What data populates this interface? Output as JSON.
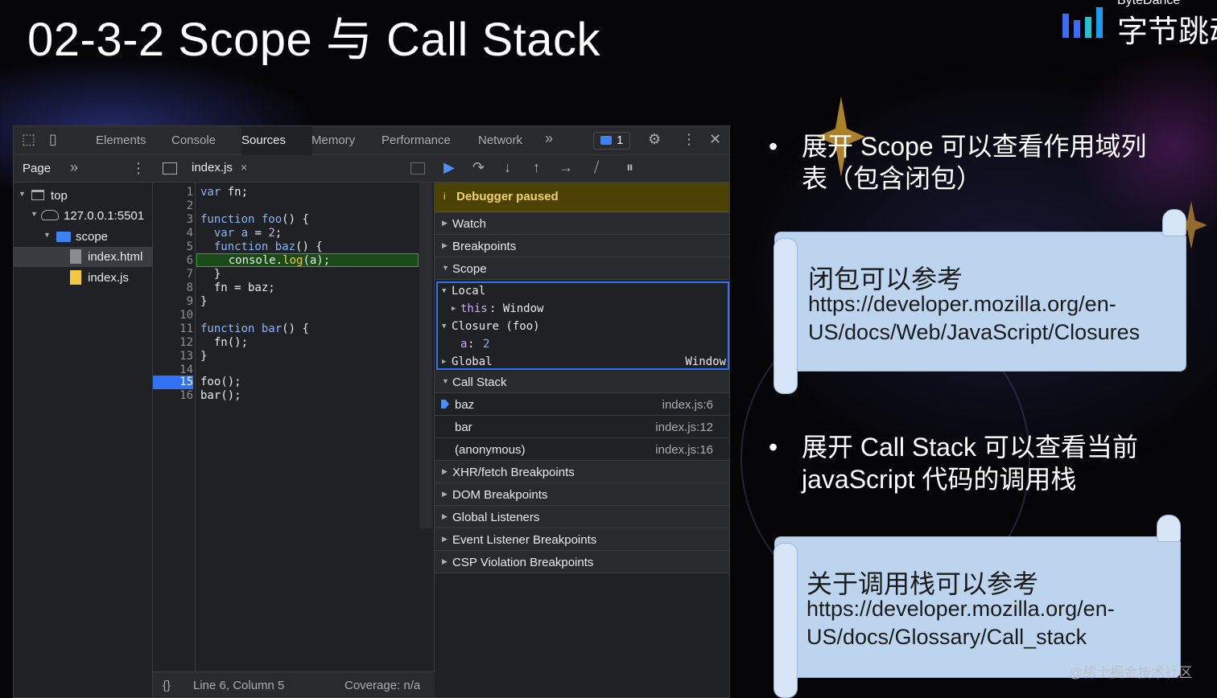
{
  "slide": {
    "title": "02-3-2 Scope 与 Call Stack"
  },
  "brand": {
    "en": "ByteDance",
    "cn": "字节跳动",
    "colors": [
      "#3b6cf5",
      "#22c1d4",
      "#1a9cf0"
    ]
  },
  "devtools": {
    "tabs": [
      "Elements",
      "Console",
      "Sources",
      "Memory",
      "Performance",
      "Network"
    ],
    "active_tab": "Sources",
    "more_tabs_icon": "»",
    "message_count": "1",
    "left_panel": {
      "title": "Page",
      "more": "»",
      "tree": [
        {
          "label": "top",
          "icon": "frame-icon"
        },
        {
          "label": "127.0.0.1:5501",
          "icon": "cloud-icon"
        },
        {
          "label": "scope",
          "icon": "folder-icon"
        },
        {
          "label": "index.html",
          "icon": "file-icon"
        },
        {
          "label": "index.js",
          "icon": "js-file-icon"
        }
      ]
    },
    "editor": {
      "file_name": "index.js",
      "close": "×",
      "lines": [
        "1",
        "2",
        "3",
        "4",
        "5",
        "6",
        "7",
        "8",
        "9",
        "10",
        "11",
        "12",
        "13",
        "14",
        "15",
        "16"
      ],
      "breakpoint_line": "15",
      "code": {
        "l1_kw": "var",
        "l1_rest": " fn;",
        "l3_kw": "function",
        "l3_fn": " foo",
        "l3_rest": "() {",
        "l4_kw": "  var",
        "l4_var": " a",
        "l4_eq": " = ",
        "l4_num": "2",
        "l4_end": ";",
        "l5_kw": "  function",
        "l5_fn": " baz",
        "l5_rest": "() {",
        "l6_a": "    console.",
        "l6_b": "log",
        "l6_c": "(a);",
        "l7": "  }",
        "l8": "  fn = baz;",
        "l9": "}",
        "l11_kw": "function",
        "l11_fn": " bar",
        "l11_rest": "() {",
        "l12": "  fn();",
        "l13": "}",
        "l15": "foo();",
        "l16": "bar();"
      },
      "footer": {
        "braces": "{}",
        "position": "Line 6, Column 5",
        "coverage": "Coverage: n/a"
      }
    },
    "debugger": {
      "paused_text": "Debugger paused",
      "sections": [
        "Watch",
        "Breakpoints",
        "Scope"
      ],
      "scope": {
        "local": "Local",
        "this_key": "this",
        "this_val": ": Window",
        "closure": "Closure (foo)",
        "a_key": "a",
        "a_sep": ": ",
        "a_val": "2",
        "global": "Global",
        "global_val": "Window"
      },
      "call_stack_title": "Call Stack",
      "call_stack": [
        {
          "fn": "baz",
          "loc": "index.js:6"
        },
        {
          "fn": "bar",
          "loc": "index.js:12"
        },
        {
          "fn": "(anonymous)",
          "loc": "index.js:16"
        }
      ],
      "more_sections": [
        "XHR/fetch Breakpoints",
        "DOM Breakpoints",
        "Global Listeners",
        "Event Listener Breakpoints",
        "CSP Violation Breakpoints"
      ]
    }
  },
  "notes": {
    "bullet1_line1": "展开 Scope 可以查看作用域列",
    "bullet1_line2": "表（包含闭包）",
    "card1_title": "闭包可以参考",
    "card1_url1": "https://developer.mozilla.org/en-",
    "card1_url2": "US/docs/Web/JavaScript/Closures",
    "bullet2_line1": "展开 Call Stack 可以查看当前",
    "bullet2_line2": "javaScript 代码的调用栈",
    "card2_title": "关于调用栈可以参考",
    "card2_url1": "https://developer.mozilla.org/en-",
    "card2_url2": "US/docs/Glossary/Call_stack"
  },
  "watermark": "@稀土掘金技术社区"
}
